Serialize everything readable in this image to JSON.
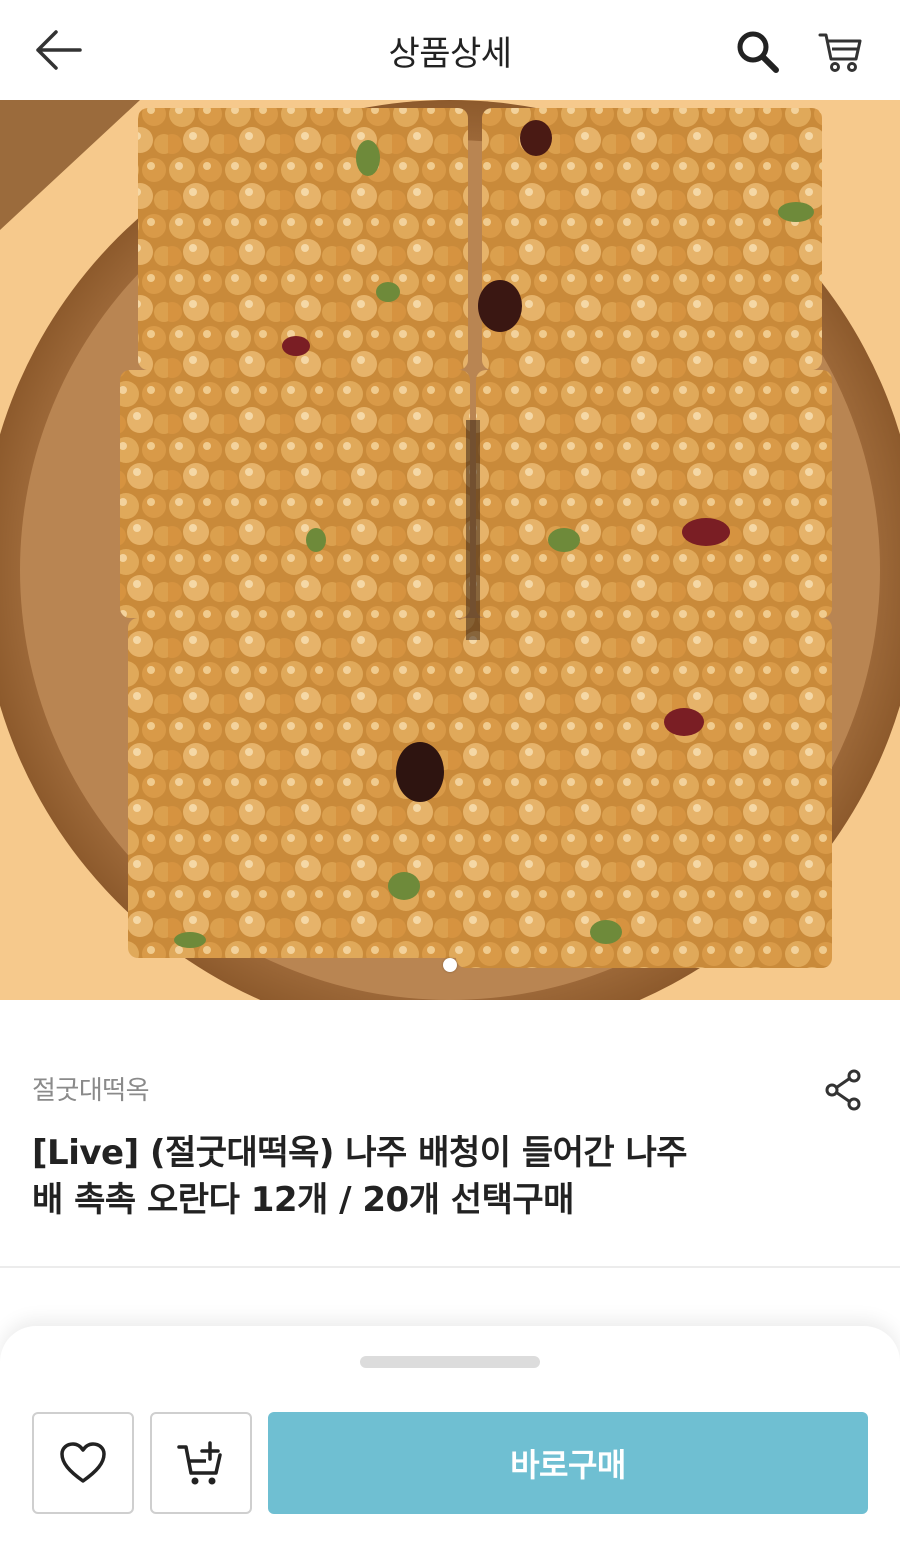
{
  "header": {
    "title": "상품상세",
    "icons": [
      "back-arrow-icon",
      "search-icon",
      "cart-icon"
    ]
  },
  "hero": {
    "image_description_icon": "product-photo",
    "pagination": {
      "current": 1,
      "total": 1
    }
  },
  "product": {
    "brand": "절굿대떡옥",
    "title_line1": "[Live] (절굿대떡옥) 나주 배청이 들어간 나주",
    "title_line2": "배 촉촉 오란다 12개 / 20개 선택구매",
    "share_icon": "share-icon"
  },
  "bottom_bar": {
    "wish_icon": "heart-icon",
    "cart_add_icon": "cart-add-icon",
    "buy_label": "바로구매",
    "buy_color": "#6fbfd2"
  }
}
